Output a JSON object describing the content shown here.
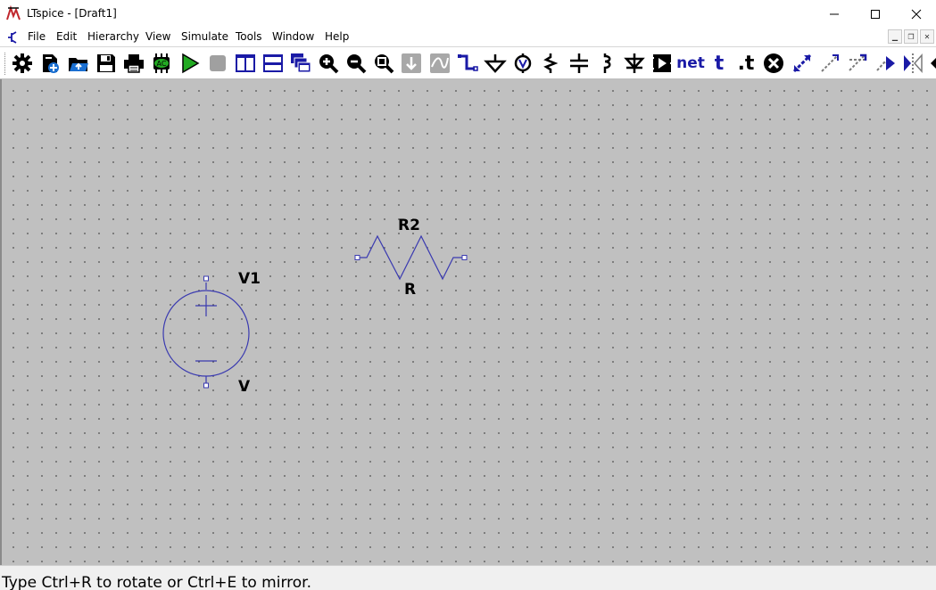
{
  "window": {
    "title": "LTspice - [Draft1]",
    "minimize_icon": "minimize-icon",
    "maximize_icon": "maximize-icon",
    "close_icon": "close-icon"
  },
  "menu": {
    "items": [
      "File",
      "Edit",
      "Hierarchy",
      "View",
      "Simulate",
      "Tools",
      "Window",
      "Help"
    ]
  },
  "toolbar": {
    "net_label": "net",
    "text_label": "t",
    "spice_directive_label": ".t",
    "ac_label": "AC",
    "buttons": [
      "settings",
      "new-schematic",
      "open",
      "save",
      "print",
      "ac-analysis",
      "run",
      "halt",
      "tile-vertical",
      "tile-horizontal",
      "cascade",
      "zoom-in",
      "zoom-out",
      "zoom-fit",
      "pan",
      "waveform",
      "wire",
      "ground",
      "voltage-probe",
      "resistor",
      "capacitor",
      "inductor",
      "diode",
      "component",
      "net-label",
      "text",
      "spice-directive",
      "delete",
      "move",
      "drag",
      "copy",
      "redo",
      "mirror",
      "rotate"
    ],
    "accent_color": "#1a1aa6",
    "run_color": "#22aa22"
  },
  "schematic": {
    "components": [
      {
        "type": "voltage-source",
        "ref": "V1",
        "value": "V"
      },
      {
        "type": "resistor",
        "ref": "R2",
        "value": "R"
      }
    ],
    "wire_color": "#3a3ab0",
    "background_color": "#c0c0c0"
  },
  "status": {
    "text": "Type Ctrl+R to rotate or Ctrl+E to mirror."
  }
}
